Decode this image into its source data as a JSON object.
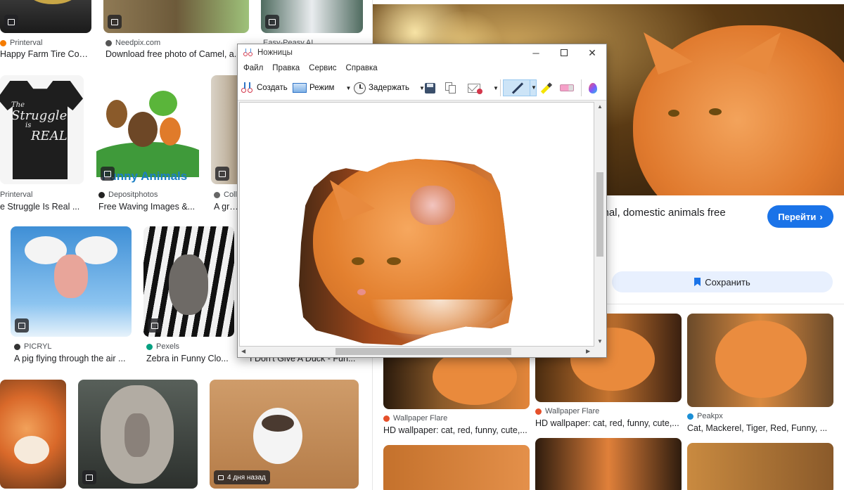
{
  "grid": {
    "row1": [
      {
        "source": "Printerval",
        "caption": "Happy Farm Tire Cov..."
      },
      {
        "source": "Needpix.com",
        "caption": "Download free photo of Camel, a..."
      },
      {
        "source": "Easy-Peasy.AI",
        "caption": ""
      }
    ],
    "row2": [
      {
        "source": "Printerval",
        "caption": "e Struggle Is Real ..."
      },
      {
        "source": "Depositphotos",
        "caption": "Free Waving Images &..."
      },
      {
        "source": "Colle",
        "caption": "A grou"
      }
    ],
    "row3": [
      {
        "source": "PICRYL",
        "caption": "A pig flying through the air ..."
      },
      {
        "source": "Pexels",
        "caption": "Zebra in Funny Clo..."
      },
      {
        "source": "",
        "caption": "I Don't Give A Duck - Fun..."
      }
    ],
    "row4_badge": "4 дня назад",
    "tshirt_text": [
      "The",
      "Struggle",
      "is",
      "REAL"
    ],
    "funny_animals_text": "Funny Animals"
  },
  "panel": {
    "title": "imal, domestic animals free",
    "go_label": "Перейти",
    "save_label": "Сохранить",
    "related": [
      {
        "source": "Wallpaper Flare",
        "caption": "HD wallpaper: cat, red, funny, cute,..."
      },
      {
        "source": "Wallpaper Flare",
        "caption": "HD wallpaper: cat, red, funny, cute,..."
      },
      {
        "source": "Peakpx",
        "caption": "Cat, Mackerel, Tiger, Red, Funny, ..."
      }
    ]
  },
  "snip": {
    "title": "Ножницы",
    "menu": [
      "Файл",
      "Правка",
      "Сервис",
      "Справка"
    ],
    "new_label": "Создать",
    "mode_label": "Режим",
    "delay_label": "Задержать"
  },
  "colors": {
    "accent": "#1a73e8",
    "save_bg": "#e8f0fe",
    "pen_active": "#cce4f7"
  }
}
